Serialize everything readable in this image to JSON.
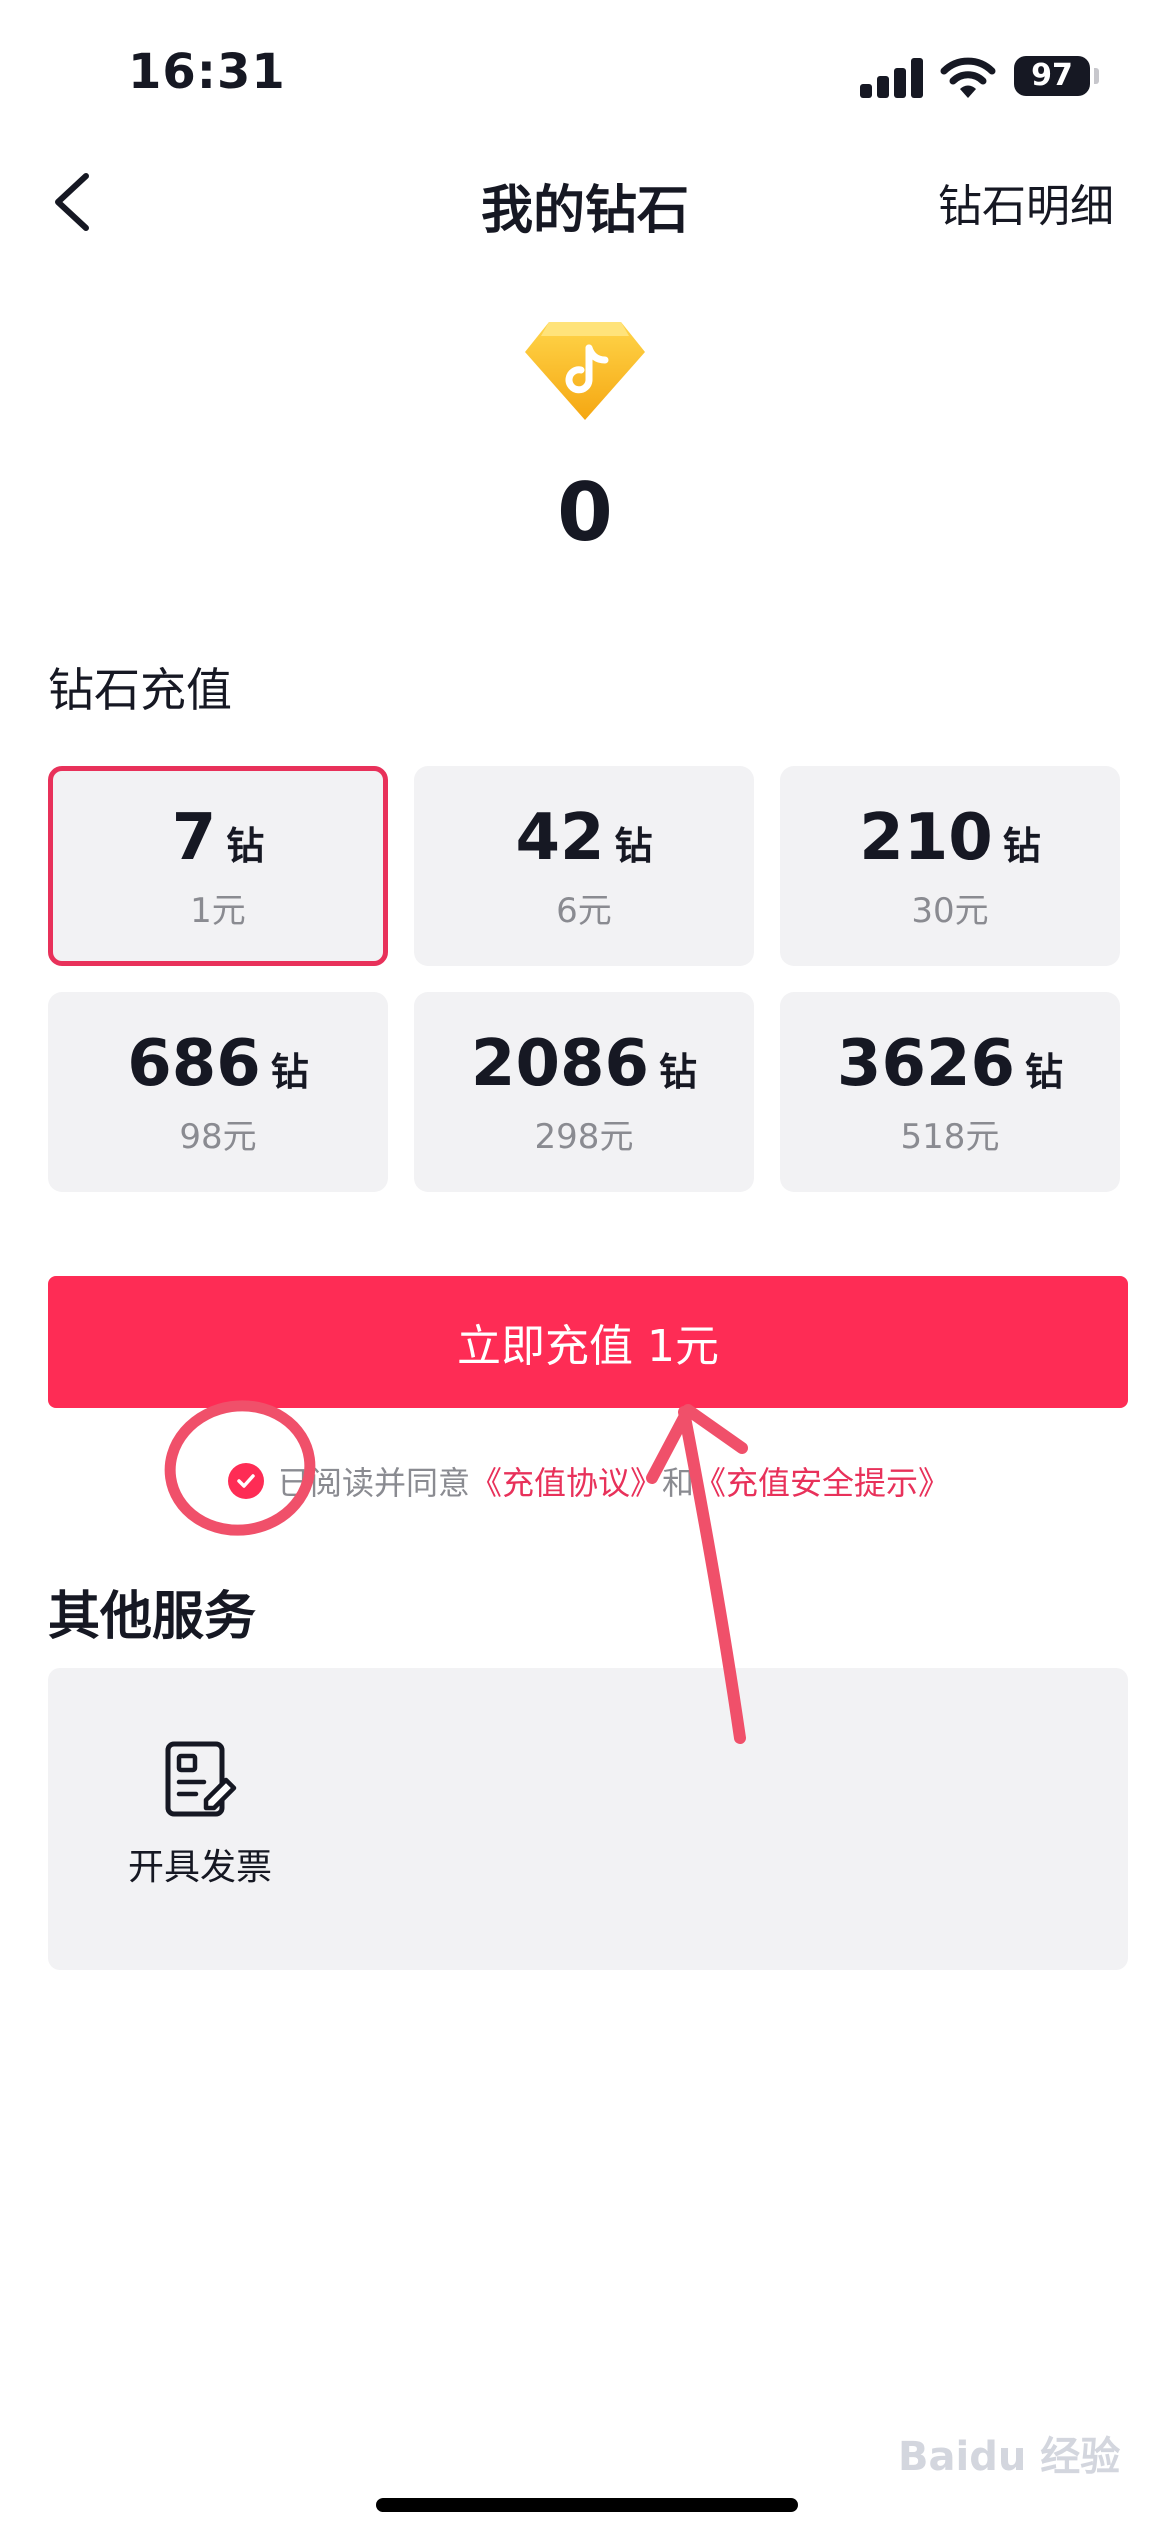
{
  "status_bar": {
    "time": "16:31",
    "battery": "97"
  },
  "nav": {
    "title": "我的钻石",
    "right_link": "钻石明细"
  },
  "balance": {
    "value": "0"
  },
  "recharge": {
    "section_title": "钻石充值",
    "packages": [
      {
        "amount": "7",
        "unit": "钻",
        "price": "1元",
        "selected": true
      },
      {
        "amount": "42",
        "unit": "钻",
        "price": "6元"
      },
      {
        "amount": "210",
        "unit": "钻",
        "price": "30元"
      },
      {
        "amount": "686",
        "unit": "钻",
        "price": "98元"
      },
      {
        "amount": "2086",
        "unit": "钻",
        "price": "298元"
      },
      {
        "amount": "3626",
        "unit": "钻",
        "price": "518元"
      }
    ],
    "button_label": "立即充值 1元"
  },
  "agreement": {
    "prefix": "已阅读并同意",
    "link1": "《充值协议》",
    "connector": "和",
    "link2": "《充值安全提示》"
  },
  "services": {
    "title": "其他服务",
    "items": [
      {
        "label": "开具发票",
        "icon": "invoice-icon"
      }
    ]
  },
  "watermark": "Baidu 经验",
  "colors": {
    "accent": "#fe2c55",
    "selected_border": "#e8315a",
    "annotation": "#f0506a",
    "card_bg": "#f2f2f4"
  }
}
